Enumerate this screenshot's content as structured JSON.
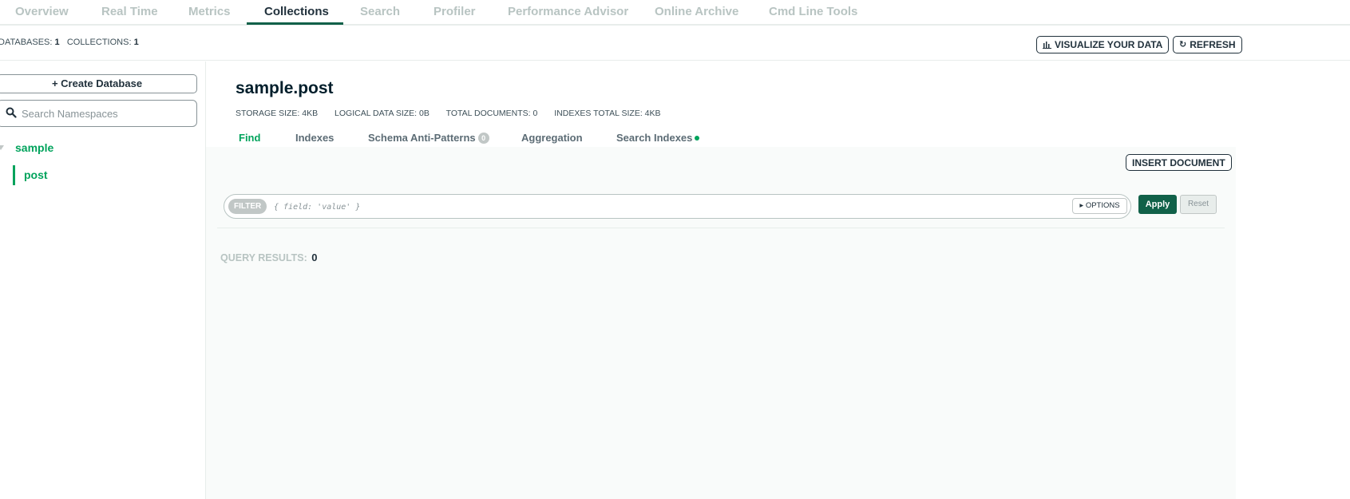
{
  "topnav": {
    "tabs": [
      {
        "label": "Overview"
      },
      {
        "label": "Real Time"
      },
      {
        "label": "Metrics"
      },
      {
        "label": "Collections"
      },
      {
        "label": "Search"
      },
      {
        "label": "Profiler"
      },
      {
        "label": "Performance Advisor"
      },
      {
        "label": "Online Archive"
      },
      {
        "label": "Cmd Line Tools"
      }
    ],
    "active": "Collections"
  },
  "statsbar": {
    "databases_label": "DATABASES:",
    "databases_value": "1",
    "collections_label": "COLLECTIONS:",
    "collections_value": "1",
    "visualize_label": "VISUALIZE YOUR DATA",
    "refresh_label": "REFRESH"
  },
  "sidebar": {
    "create_db_label": "+ Create Database",
    "search_placeholder": "Search Namespaces",
    "database": "sample",
    "collection": "post"
  },
  "main": {
    "namespace": "sample.post",
    "stats": {
      "storage": "STORAGE SIZE: 4KB",
      "logical": "LOGICAL DATA SIZE: 0B",
      "documents": "TOTAL DOCUMENTS: 0",
      "indexes": "INDEXES TOTAL SIZE: 4KB"
    },
    "subtabs": {
      "find": "Find",
      "indexes": "Indexes",
      "schema": "Schema Anti-Patterns",
      "schema_count": "0",
      "aggregation": "Aggregation",
      "search_indexes": "Search Indexes"
    },
    "insert_label": "INSERT DOCUMENT",
    "filter": {
      "pill": "FILTER",
      "placeholder": "{ field: 'value' }",
      "options_label": "OPTIONS"
    },
    "apply_label": "Apply",
    "reset_label": "Reset",
    "query_results_label": "QUERY RESULTS:",
    "query_results_value": "0"
  },
  "colors": {
    "accent_green": "#00a35c",
    "dark_green": "#116149",
    "text_dark": "#21313c",
    "muted": "#b8c4c2"
  }
}
